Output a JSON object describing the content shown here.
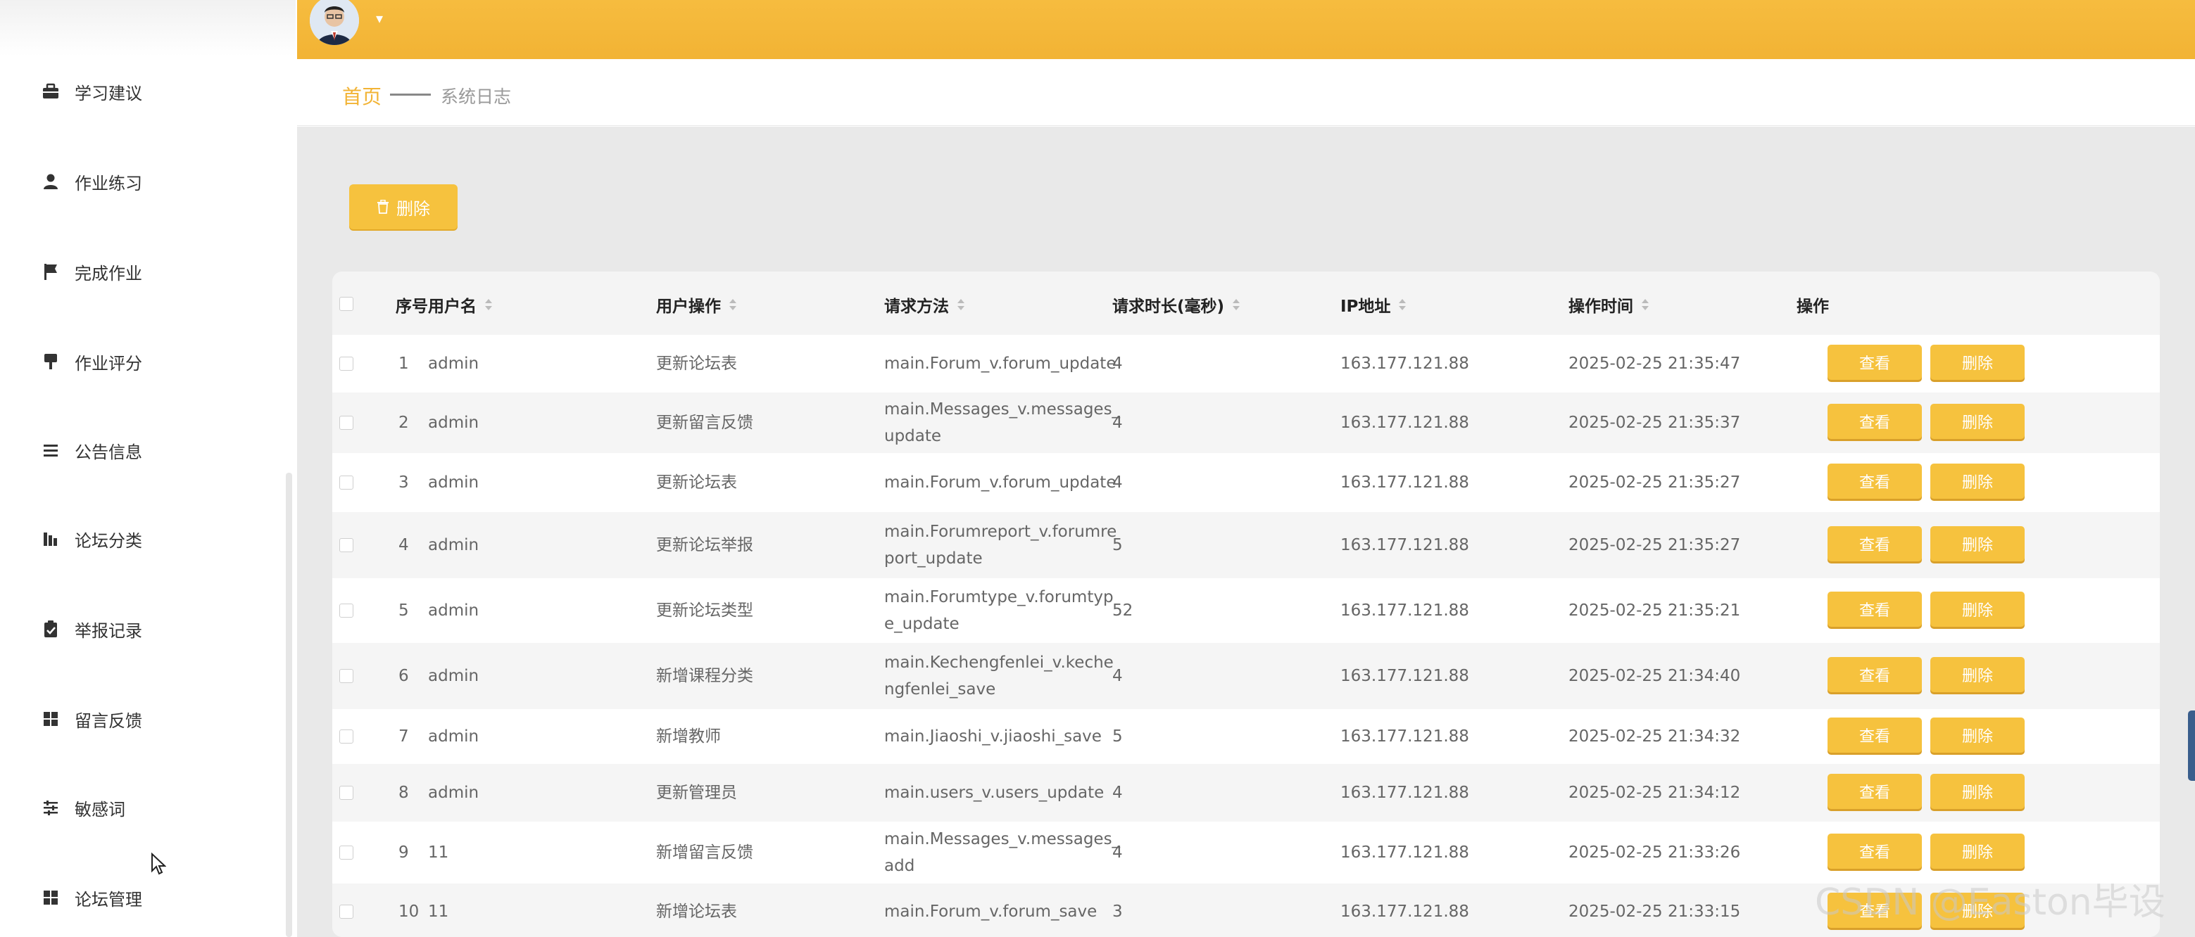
{
  "colors": {
    "accent": "#f2b334",
    "button": "#f6c23e",
    "content_bg": "#e9e9e9"
  },
  "sidebar": {
    "items": [
      {
        "label": "学习建议",
        "icon": "briefcase-icon"
      },
      {
        "label": "作业练习",
        "icon": "user-icon"
      },
      {
        "label": "完成作业",
        "icon": "flag-icon"
      },
      {
        "label": "作业评分",
        "icon": "stamp-icon"
      },
      {
        "label": "公告信息",
        "icon": "list-icon"
      },
      {
        "label": "论坛分类",
        "icon": "bar-chart-icon"
      },
      {
        "label": "举报记录",
        "icon": "clipboard-check-icon"
      },
      {
        "label": "留言反馈",
        "icon": "grid-icon"
      },
      {
        "label": "敏感词",
        "icon": "sliders-icon"
      },
      {
        "label": "论坛管理",
        "icon": "grid-icon"
      }
    ]
  },
  "header": {
    "avatar_icon": "user-avatar-icon"
  },
  "breadcrumb": {
    "home": "首页",
    "current": "系统日志"
  },
  "toolbar": {
    "delete_label": "删除"
  },
  "table": {
    "headers": {
      "index": "序号",
      "username": "用户名",
      "operation": "用户操作",
      "method": "请求方法",
      "duration": "请求时长(毫秒)",
      "ip": "IP地址",
      "time": "操作时间",
      "actions": "操作"
    },
    "view_label": "查看",
    "delete_label": "删除",
    "rows": [
      {
        "index": "1",
        "username": "admin",
        "operation": "更新论坛表",
        "method": [
          "main.Forum_v.forum_update"
        ],
        "duration": "4",
        "ip": "163.177.121.88",
        "time": "2025-02-25 21:35:47"
      },
      {
        "index": "2",
        "username": "admin",
        "operation": "更新留言反馈",
        "method": [
          "main.Messages_v.messages_",
          "update"
        ],
        "duration": "4",
        "ip": "163.177.121.88",
        "time": "2025-02-25 21:35:37"
      },
      {
        "index": "3",
        "username": "admin",
        "operation": "更新论坛表",
        "method": [
          "main.Forum_v.forum_update"
        ],
        "duration": "4",
        "ip": "163.177.121.88",
        "time": "2025-02-25 21:35:27"
      },
      {
        "index": "4",
        "username": "admin",
        "operation": "更新论坛举报",
        "method": [
          "main.Forumreport_v.forumre",
          "port_update"
        ],
        "duration": "5",
        "ip": "163.177.121.88",
        "time": "2025-02-25 21:35:27"
      },
      {
        "index": "5",
        "username": "admin",
        "operation": "更新论坛类型",
        "method": [
          "main.Forumtype_v.forumtyp",
          "e_update"
        ],
        "duration": "52",
        "ip": "163.177.121.88",
        "time": "2025-02-25 21:35:21"
      },
      {
        "index": "6",
        "username": "admin",
        "operation": "新增课程分类",
        "method": [
          "main.Kechengfenlei_v.keche",
          "ngfenlei_save"
        ],
        "duration": "4",
        "ip": "163.177.121.88",
        "time": "2025-02-25 21:34:40"
      },
      {
        "index": "7",
        "username": "admin",
        "operation": "新增教师",
        "method": [
          "main.Jiaoshi_v.jiaoshi_save"
        ],
        "duration": "5",
        "ip": "163.177.121.88",
        "time": "2025-02-25 21:34:32"
      },
      {
        "index": "8",
        "username": "admin",
        "operation": "更新管理员",
        "method": [
          "main.users_v.users_update"
        ],
        "duration": "4",
        "ip": "163.177.121.88",
        "time": "2025-02-25 21:34:12"
      },
      {
        "index": "9",
        "username": "11",
        "operation": "新增留言反馈",
        "method": [
          "main.Messages_v.messages_",
          "add"
        ],
        "duration": "4",
        "ip": "163.177.121.88",
        "time": "2025-02-25 21:33:26"
      },
      {
        "index": "10",
        "username": "11",
        "operation": "新增论坛表",
        "method": [
          "main.Forum_v.forum_save"
        ],
        "duration": "3",
        "ip": "163.177.121.88",
        "time": "2025-02-25 21:33:15"
      }
    ]
  },
  "watermark": "CSDN @Easton毕设"
}
